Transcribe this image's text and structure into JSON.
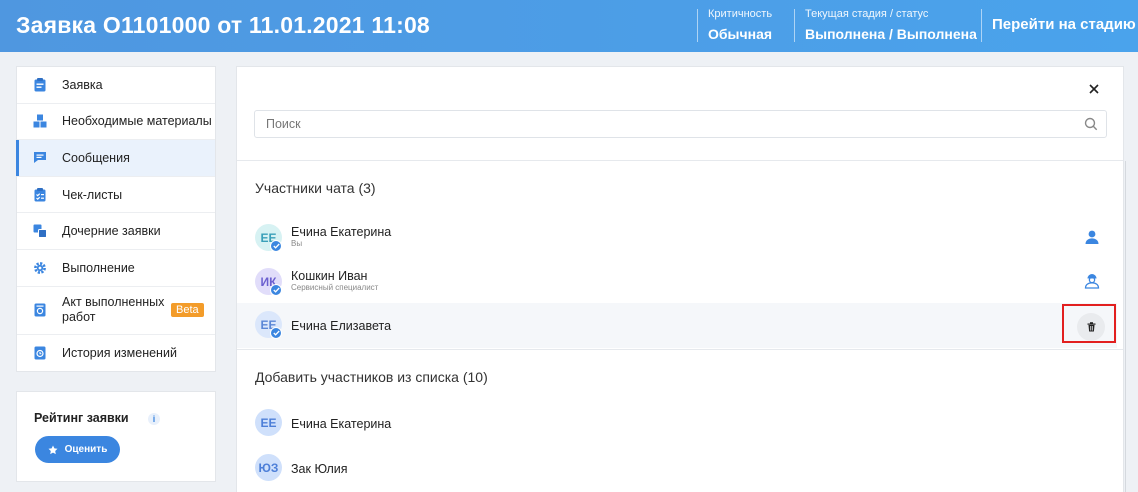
{
  "header": {
    "title": "Заявка О1101000 от 11.01.2021 11:08",
    "criticality_label": "Критичность",
    "criticality_value": "Обычная",
    "stage_label": "Текущая стадия / статус",
    "stage_value": "Выполнена / Выполнена",
    "goto_stage": "Перейти на стадию"
  },
  "sidebar": {
    "items": [
      {
        "label": "Заявка",
        "icon": "clipboard-icon"
      },
      {
        "label": "Необходимые материалы",
        "icon": "boxes-icon"
      },
      {
        "label": "Сообщения",
        "icon": "message-icon",
        "active": true
      },
      {
        "label": "Чек-листы",
        "icon": "checklist-icon"
      },
      {
        "label": "Дочерние заявки",
        "icon": "child-requests-icon"
      },
      {
        "label": "Выполнение",
        "icon": "gear-icon"
      },
      {
        "label": "Акт выполненных работ",
        "icon": "act-icon",
        "badge": "Beta"
      },
      {
        "label": "История изменений",
        "icon": "history-icon"
      }
    ]
  },
  "rating": {
    "title": "Рейтинг заявки",
    "info": "i",
    "button": "Оценить"
  },
  "panel": {
    "search_placeholder": "Поиск",
    "participants_title": "Участники чата (3)",
    "participants": [
      {
        "initials": "ЕЕ",
        "name": "Ечина Екатерина",
        "role": "Вы",
        "role_icon": "person-icon"
      },
      {
        "initials": "ИК",
        "name": "Кошкин Иван",
        "role": "Сервисный специалист",
        "role_icon": "engineer-icon"
      },
      {
        "initials": "ЕЕ",
        "name": "Ечина Елизавета",
        "role": "",
        "action": "trash-icon"
      }
    ],
    "add_title": "Добавить участников из списка (10)",
    "candidates": [
      {
        "initials": "ЕЕ",
        "name": "Ечина Екатерина"
      },
      {
        "initials": "ЮЗ",
        "name": "Зак Юлия"
      }
    ]
  },
  "colors": {
    "header_gradient": "#4f97e0",
    "accent": "#3b86e0",
    "beta": "#f39c2a",
    "highlight_frame": "#e21f1f"
  }
}
